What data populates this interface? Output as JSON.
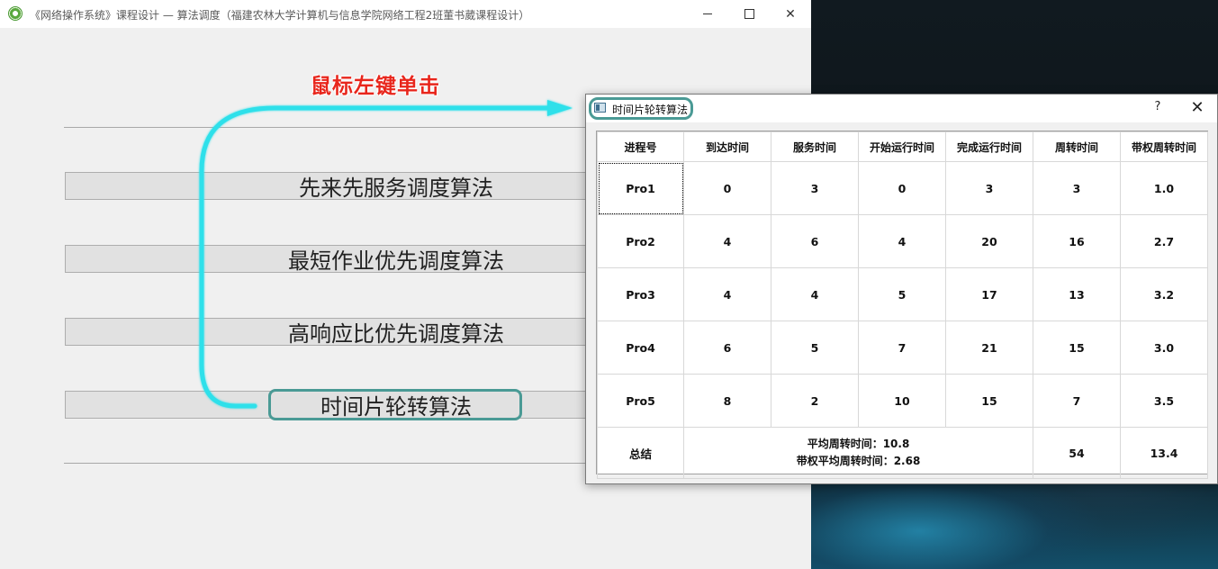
{
  "main_window": {
    "title": "《网络操作系统》课程设计 — 算法调度（福建农林大学计算机与信息学院网络工程2班董书葳课程设计）",
    "buttons": [
      "先来先服务调度算法",
      "最短作业优先调度算法",
      "高响应比优先调度算法",
      "时间片轮转算法"
    ],
    "highlighted_button_index": 3
  },
  "annotation": {
    "text": "鼠标左键单击",
    "color": "#e8261c",
    "arrow_color": "#2de0ea"
  },
  "dialog": {
    "title": "时间片轮转算法",
    "help": "?",
    "close": "✕",
    "table": {
      "headers": [
        "进程号",
        "到达时间",
        "服务时间",
        "开始运行时间",
        "完成运行时间",
        "周转时间",
        "带权周转时间"
      ],
      "rows": [
        [
          "Pro1",
          "0",
          "3",
          "0",
          "3",
          "3",
          "1.0"
        ],
        [
          "Pro2",
          "4",
          "6",
          "4",
          "20",
          "16",
          "2.7"
        ],
        [
          "Pro3",
          "4",
          "4",
          "5",
          "17",
          "13",
          "3.2"
        ],
        [
          "Pro4",
          "6",
          "5",
          "7",
          "21",
          "15",
          "3.0"
        ],
        [
          "Pro5",
          "8",
          "2",
          "10",
          "15",
          "7",
          "3.5"
        ]
      ],
      "summary": {
        "label": "总结",
        "avg_turnaround": "平均周转时间：10.8",
        "avg_weighted_turnaround": "带权平均周转时间：2.68",
        "total_turnaround": "54",
        "total_weighted_turnaround": "13.4"
      }
    }
  },
  "colors": {
    "highlight_ring": "#4a9a95",
    "button_face": "#e1e1e1"
  }
}
